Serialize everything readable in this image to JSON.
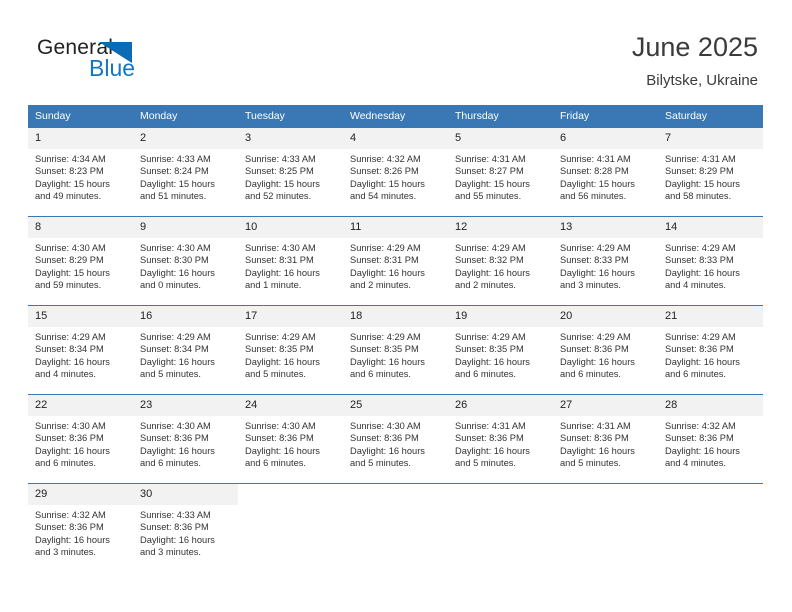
{
  "brand": {
    "name_part1": "General",
    "name_part2": "Blue",
    "triangle_color": "#0b6cb5",
    "blue_text_color": "#1577c4"
  },
  "header": {
    "title": "June 2025",
    "subtitle": "Bilytske, Ukraine"
  },
  "theme": {
    "header_row_color": "#3a78b5",
    "daynum_bg": "#f2f2f2",
    "grid_line_color": "#3a78b5"
  },
  "weekday_headers": [
    "Sunday",
    "Monday",
    "Tuesday",
    "Wednesday",
    "Thursday",
    "Friday",
    "Saturday"
  ],
  "weeks": [
    [
      {
        "day": "1",
        "sunrise": "Sunrise: 4:34 AM",
        "sunset": "Sunset: 8:23 PM",
        "daylight_line1": "Daylight: 15 hours",
        "daylight_line2": "and 49 minutes."
      },
      {
        "day": "2",
        "sunrise": "Sunrise: 4:33 AM",
        "sunset": "Sunset: 8:24 PM",
        "daylight_line1": "Daylight: 15 hours",
        "daylight_line2": "and 51 minutes."
      },
      {
        "day": "3",
        "sunrise": "Sunrise: 4:33 AM",
        "sunset": "Sunset: 8:25 PM",
        "daylight_line1": "Daylight: 15 hours",
        "daylight_line2": "and 52 minutes."
      },
      {
        "day": "4",
        "sunrise": "Sunrise: 4:32 AM",
        "sunset": "Sunset: 8:26 PM",
        "daylight_line1": "Daylight: 15 hours",
        "daylight_line2": "and 54 minutes."
      },
      {
        "day": "5",
        "sunrise": "Sunrise: 4:31 AM",
        "sunset": "Sunset: 8:27 PM",
        "daylight_line1": "Daylight: 15 hours",
        "daylight_line2": "and 55 minutes."
      },
      {
        "day": "6",
        "sunrise": "Sunrise: 4:31 AM",
        "sunset": "Sunset: 8:28 PM",
        "daylight_line1": "Daylight: 15 hours",
        "daylight_line2": "and 56 minutes."
      },
      {
        "day": "7",
        "sunrise": "Sunrise: 4:31 AM",
        "sunset": "Sunset: 8:29 PM",
        "daylight_line1": "Daylight: 15 hours",
        "daylight_line2": "and 58 minutes."
      }
    ],
    [
      {
        "day": "8",
        "sunrise": "Sunrise: 4:30 AM",
        "sunset": "Sunset: 8:29 PM",
        "daylight_line1": "Daylight: 15 hours",
        "daylight_line2": "and 59 minutes."
      },
      {
        "day": "9",
        "sunrise": "Sunrise: 4:30 AM",
        "sunset": "Sunset: 8:30 PM",
        "daylight_line1": "Daylight: 16 hours",
        "daylight_line2": "and 0 minutes."
      },
      {
        "day": "10",
        "sunrise": "Sunrise: 4:30 AM",
        "sunset": "Sunset: 8:31 PM",
        "daylight_line1": "Daylight: 16 hours",
        "daylight_line2": "and 1 minute."
      },
      {
        "day": "11",
        "sunrise": "Sunrise: 4:29 AM",
        "sunset": "Sunset: 8:31 PM",
        "daylight_line1": "Daylight: 16 hours",
        "daylight_line2": "and 2 minutes."
      },
      {
        "day": "12",
        "sunrise": "Sunrise: 4:29 AM",
        "sunset": "Sunset: 8:32 PM",
        "daylight_line1": "Daylight: 16 hours",
        "daylight_line2": "and 2 minutes."
      },
      {
        "day": "13",
        "sunrise": "Sunrise: 4:29 AM",
        "sunset": "Sunset: 8:33 PM",
        "daylight_line1": "Daylight: 16 hours",
        "daylight_line2": "and 3 minutes."
      },
      {
        "day": "14",
        "sunrise": "Sunrise: 4:29 AM",
        "sunset": "Sunset: 8:33 PM",
        "daylight_line1": "Daylight: 16 hours",
        "daylight_line2": "and 4 minutes."
      }
    ],
    [
      {
        "day": "15",
        "sunrise": "Sunrise: 4:29 AM",
        "sunset": "Sunset: 8:34 PM",
        "daylight_line1": "Daylight: 16 hours",
        "daylight_line2": "and 4 minutes."
      },
      {
        "day": "16",
        "sunrise": "Sunrise: 4:29 AM",
        "sunset": "Sunset: 8:34 PM",
        "daylight_line1": "Daylight: 16 hours",
        "daylight_line2": "and 5 minutes."
      },
      {
        "day": "17",
        "sunrise": "Sunrise: 4:29 AM",
        "sunset": "Sunset: 8:35 PM",
        "daylight_line1": "Daylight: 16 hours",
        "daylight_line2": "and 5 minutes."
      },
      {
        "day": "18",
        "sunrise": "Sunrise: 4:29 AM",
        "sunset": "Sunset: 8:35 PM",
        "daylight_line1": "Daylight: 16 hours",
        "daylight_line2": "and 6 minutes."
      },
      {
        "day": "19",
        "sunrise": "Sunrise: 4:29 AM",
        "sunset": "Sunset: 8:35 PM",
        "daylight_line1": "Daylight: 16 hours",
        "daylight_line2": "and 6 minutes."
      },
      {
        "day": "20",
        "sunrise": "Sunrise: 4:29 AM",
        "sunset": "Sunset: 8:36 PM",
        "daylight_line1": "Daylight: 16 hours",
        "daylight_line2": "and 6 minutes."
      },
      {
        "day": "21",
        "sunrise": "Sunrise: 4:29 AM",
        "sunset": "Sunset: 8:36 PM",
        "daylight_line1": "Daylight: 16 hours",
        "daylight_line2": "and 6 minutes."
      }
    ],
    [
      {
        "day": "22",
        "sunrise": "Sunrise: 4:30 AM",
        "sunset": "Sunset: 8:36 PM",
        "daylight_line1": "Daylight: 16 hours",
        "daylight_line2": "and 6 minutes."
      },
      {
        "day": "23",
        "sunrise": "Sunrise: 4:30 AM",
        "sunset": "Sunset: 8:36 PM",
        "daylight_line1": "Daylight: 16 hours",
        "daylight_line2": "and 6 minutes."
      },
      {
        "day": "24",
        "sunrise": "Sunrise: 4:30 AM",
        "sunset": "Sunset: 8:36 PM",
        "daylight_line1": "Daylight: 16 hours",
        "daylight_line2": "and 6 minutes."
      },
      {
        "day": "25",
        "sunrise": "Sunrise: 4:30 AM",
        "sunset": "Sunset: 8:36 PM",
        "daylight_line1": "Daylight: 16 hours",
        "daylight_line2": "and 5 minutes."
      },
      {
        "day": "26",
        "sunrise": "Sunrise: 4:31 AM",
        "sunset": "Sunset: 8:36 PM",
        "daylight_line1": "Daylight: 16 hours",
        "daylight_line2": "and 5 minutes."
      },
      {
        "day": "27",
        "sunrise": "Sunrise: 4:31 AM",
        "sunset": "Sunset: 8:36 PM",
        "daylight_line1": "Daylight: 16 hours",
        "daylight_line2": "and 5 minutes."
      },
      {
        "day": "28",
        "sunrise": "Sunrise: 4:32 AM",
        "sunset": "Sunset: 8:36 PM",
        "daylight_line1": "Daylight: 16 hours",
        "daylight_line2": "and 4 minutes."
      }
    ],
    [
      {
        "day": "29",
        "sunrise": "Sunrise: 4:32 AM",
        "sunset": "Sunset: 8:36 PM",
        "daylight_line1": "Daylight: 16 hours",
        "daylight_line2": "and 3 minutes."
      },
      {
        "day": "30",
        "sunrise": "Sunrise: 4:33 AM",
        "sunset": "Sunset: 8:36 PM",
        "daylight_line1": "Daylight: 16 hours",
        "daylight_line2": "and 3 minutes."
      },
      {
        "day": "",
        "sunrise": "",
        "sunset": "",
        "daylight_line1": "",
        "daylight_line2": ""
      },
      {
        "day": "",
        "sunrise": "",
        "sunset": "",
        "daylight_line1": "",
        "daylight_line2": ""
      },
      {
        "day": "",
        "sunrise": "",
        "sunset": "",
        "daylight_line1": "",
        "daylight_line2": ""
      },
      {
        "day": "",
        "sunrise": "",
        "sunset": "",
        "daylight_line1": "",
        "daylight_line2": ""
      },
      {
        "day": "",
        "sunrise": "",
        "sunset": "",
        "daylight_line1": "",
        "daylight_line2": ""
      }
    ]
  ]
}
